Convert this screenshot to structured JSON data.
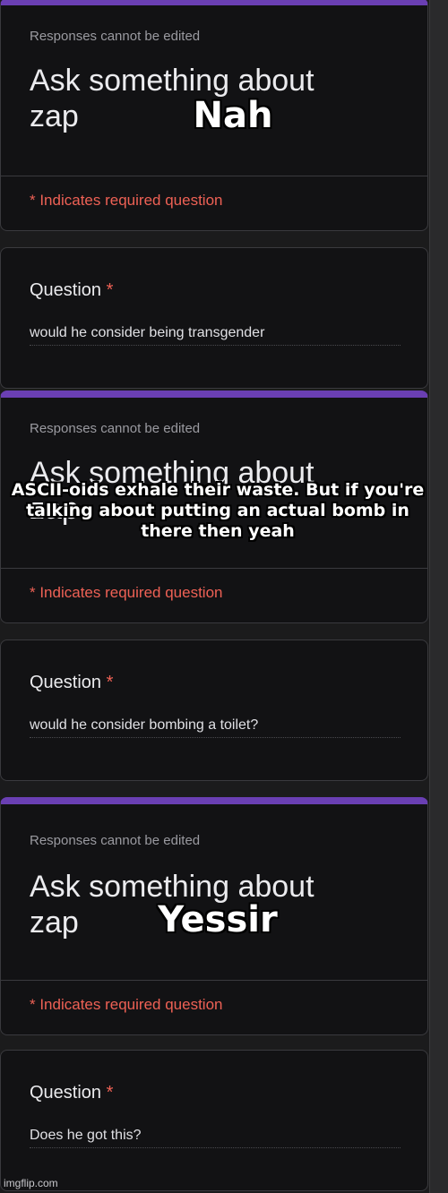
{
  "sections": [
    {
      "header": {
        "banner": "Responses cannot be edited",
        "title_line1": "Ask something about",
        "title_line2": "zap",
        "required_note": "* Indicates required question"
      },
      "question": {
        "label": "Question",
        "required_mark": "*",
        "answer": "would he consider being transgender"
      },
      "overlay_text": "Nah"
    },
    {
      "header": {
        "banner": "Responses cannot be edited",
        "title_line1": "Ask something about",
        "title_line2": "zap",
        "required_note": "* Indicates required question"
      },
      "question": {
        "label": "Question",
        "required_mark": "*",
        "answer": "would he consider bombing a toilet?"
      },
      "overlay_text": "ASCII-oids exhale their waste. But if you're talking about putting an actual bomb in there then yeah"
    },
    {
      "header": {
        "banner": "Responses cannot be edited",
        "title_line1": "Ask something about",
        "title_line2": "zap",
        "required_note": "* Indicates required question"
      },
      "question": {
        "label": "Question",
        "required_mark": "*",
        "answer": "Does he got this?"
      },
      "overlay_text": "Yessir"
    }
  ],
  "watermark": "imgflip.com",
  "colors": {
    "accent": "#6a3fb3",
    "required": "#ee6155",
    "card_bg": "#121214"
  }
}
